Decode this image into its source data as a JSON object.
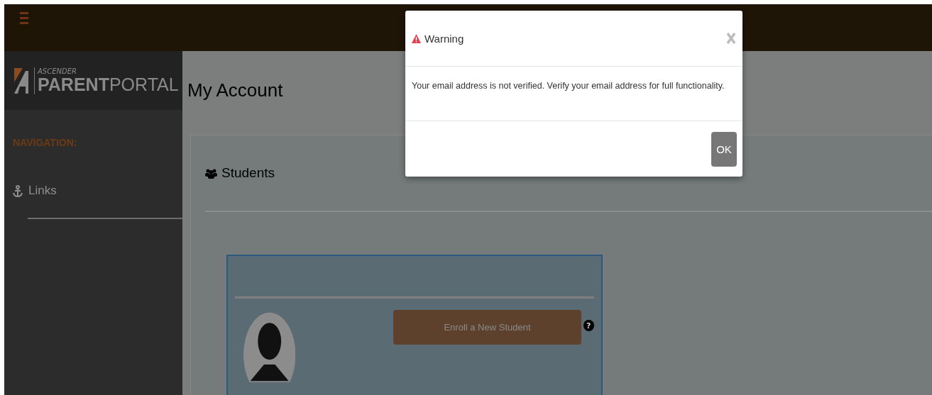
{
  "logo": {
    "small": "ASCENDER",
    "bold": "PARENT",
    "light": "PORTAL"
  },
  "sidebar": {
    "heading": "NAVIGATION:",
    "items": [
      {
        "label": "Links"
      }
    ]
  },
  "page": {
    "title": "My Account"
  },
  "students_panel": {
    "title": "Students",
    "enroll_button": "Enroll a New Student",
    "help": "?"
  },
  "dialog": {
    "title": "Warning",
    "message": "Your email address is not verified. Verify your email address for full functionality.",
    "buttons": [
      "OK"
    ]
  }
}
